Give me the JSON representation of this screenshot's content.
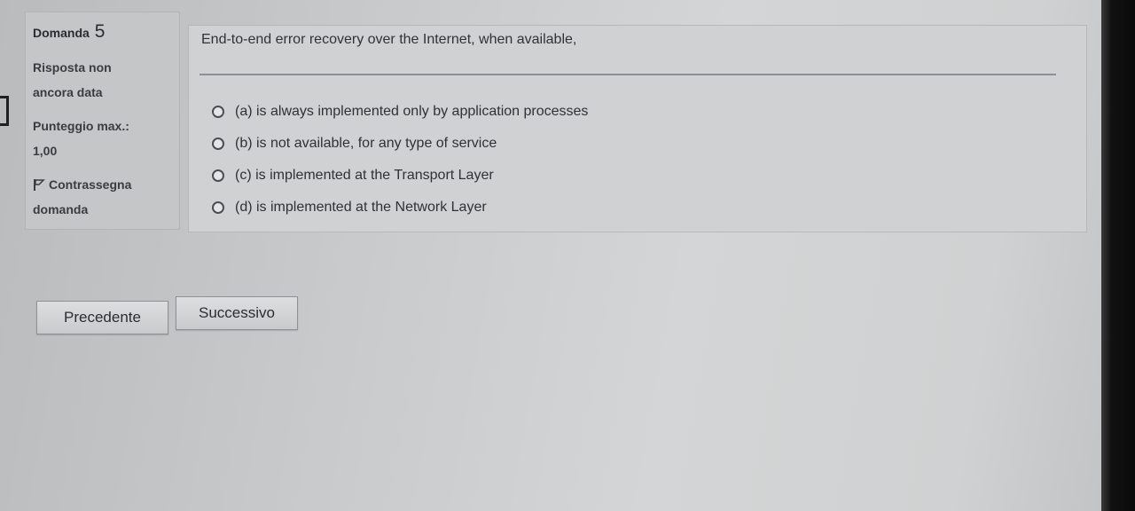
{
  "sidebar": {
    "question_label": "Domanda",
    "question_number": "5",
    "status_line1": "Risposta non",
    "status_line2": "ancora data",
    "score_label": "Punteggio max.:",
    "score_value": "1,00",
    "flag_line1": "Contrassegna",
    "flag_line2": "domanda",
    "flag_icon": "flag-icon"
  },
  "question": {
    "text": "End-to-end error recovery over the Internet, when available,",
    "options": [
      {
        "label": "(a) is always implemented only by application processes",
        "selected": false
      },
      {
        "label": "(b) is not available, for any type of service",
        "selected": false
      },
      {
        "label": "(c) is implemented at the Transport Layer",
        "selected": false
      },
      {
        "label": "(d) is implemented at the Network Layer",
        "selected": false
      }
    ]
  },
  "navigation": {
    "previous_label": "Precedente",
    "next_label": "Successivo"
  }
}
